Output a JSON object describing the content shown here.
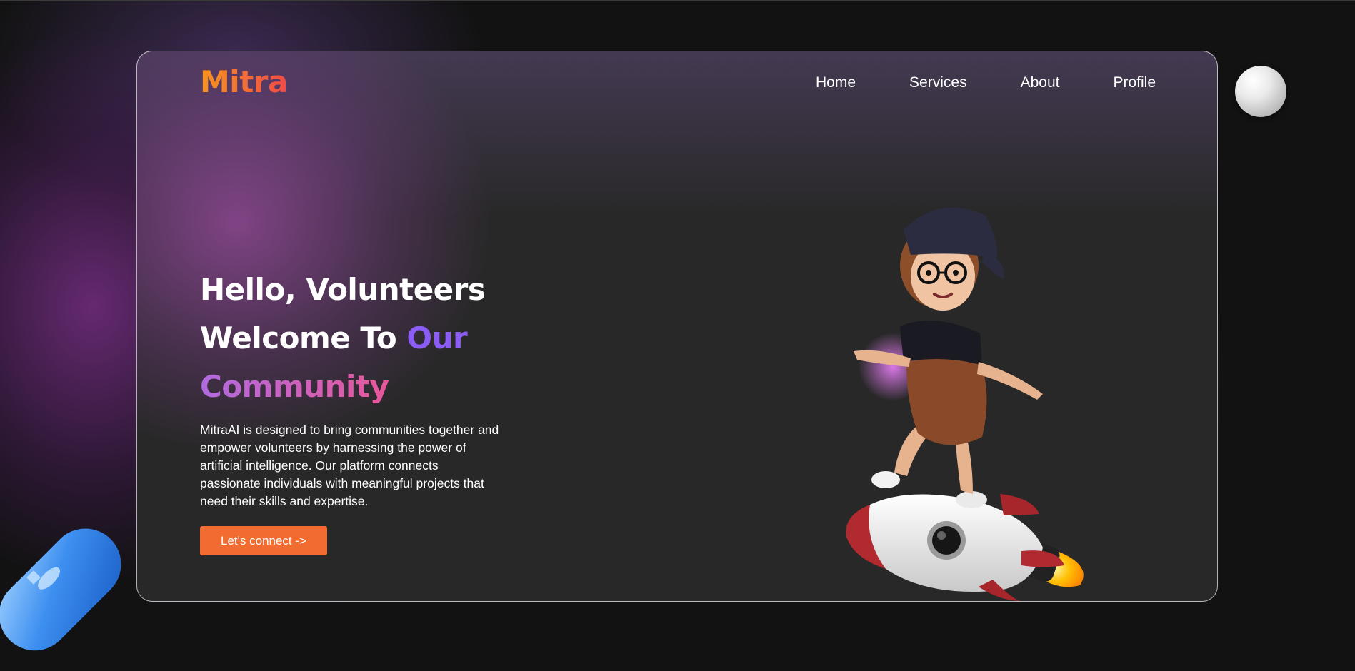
{
  "brand": {
    "logo_text": "Mitra",
    "colors": {
      "logo_gradient_start": "#f7941d",
      "logo_gradient_end": "#ef4b4b",
      "accent_purple": "#8b5cf6",
      "accent_pink": "#e8579a",
      "cta_orange": "#f26b30",
      "card_bg": "#282828",
      "page_bg": "#121212"
    }
  },
  "nav": {
    "items": [
      {
        "label": "Home"
      },
      {
        "label": "Services"
      },
      {
        "label": "About"
      },
      {
        "label": "Profile"
      }
    ]
  },
  "hero": {
    "line1": "Hello, Volunteers",
    "line2_plain": "Welcome To ",
    "line2_accent": "Our",
    "line3_accent": "Community",
    "description": "MitraAI is designed to bring communities together and empower volunteers by harnessing the power of artificial intelligence. Our platform connects passionate individuals with meaningful projects that need their skills and expertise.",
    "cta_label": "Let's connect ->"
  },
  "decorations": {
    "illustration": "girl-on-rocket-illustration",
    "sphere": "white-sphere",
    "capsule": "blue-capsule"
  }
}
